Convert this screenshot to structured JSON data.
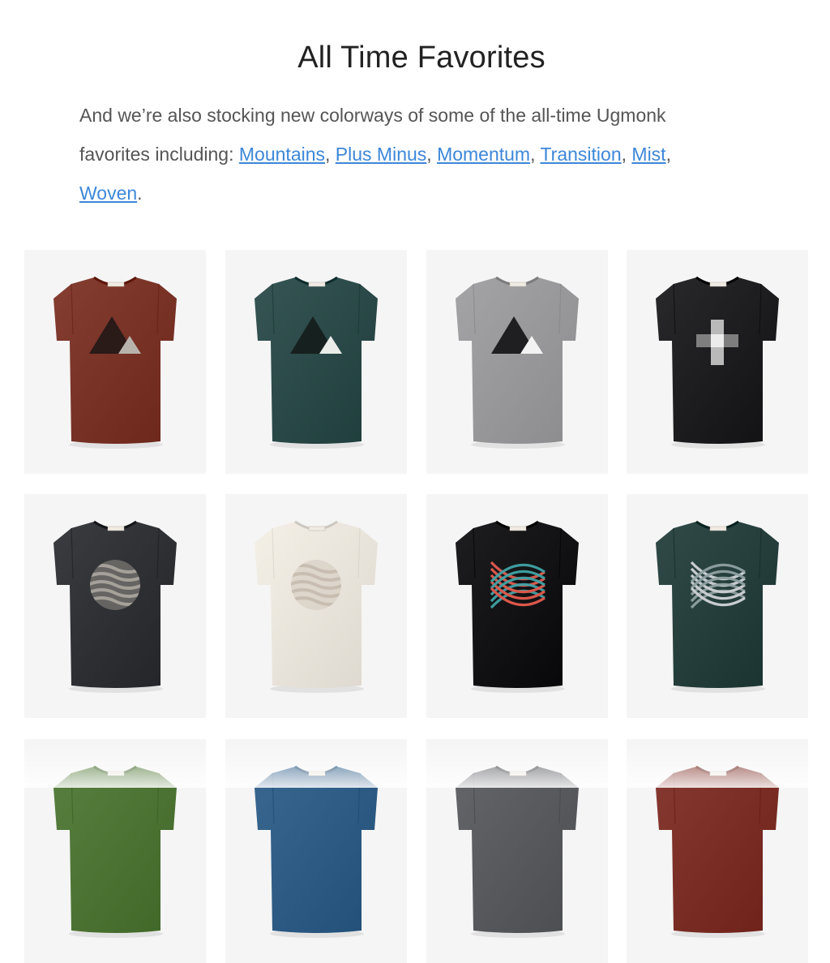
{
  "section": {
    "title": "All Time Favorites",
    "intro_line1": "And we’re also stocking new colorways of some of the all-time Ugmonk",
    "intro_prefix": "favorites including: ",
    "links": [
      "Mountains",
      "Plus Minus",
      "Momentum",
      "Transition",
      "Mist",
      "Woven"
    ],
    "separator": ", ",
    "end": "."
  },
  "products": [
    {
      "shirt_color": "#7a3428",
      "graphic": "mountains",
      "graphic_color": "#2a1a18",
      "accent_color": "#b9b3ad"
    },
    {
      "shirt_color": "#2c4b4a",
      "graphic": "mountains",
      "graphic_color": "#16201f",
      "accent_color": "#e9ece8"
    },
    {
      "shirt_color": "#9a9a9c",
      "graphic": "mountains",
      "graphic_color": "#1f1f21",
      "accent_color": "#f2f2f2"
    },
    {
      "shirt_color": "#1f1f21",
      "graphic": "plus",
      "graphic_color": "#d5d5d5",
      "accent_color": "#8a8a8a"
    },
    {
      "shirt_color": "#303236",
      "graphic": "mist",
      "graphic_color": "#8b8780",
      "accent_color": "#b5b0a8"
    },
    {
      "shirt_color": "#ebe6dd",
      "graphic": "mist",
      "graphic_color": "#d3cbbf",
      "accent_color": "#c2b8aa"
    },
    {
      "shirt_color": "#141416",
      "graphic": "woven",
      "graphic_color": "#d9574b",
      "accent_color": "#3fa3a7"
    },
    {
      "shirt_color": "#27403e",
      "graphic": "woven",
      "graphic_color": "#c7ccd0",
      "accent_color": "#8fa0a2"
    },
    {
      "shirt_color": "#4e7535",
      "graphic": "none",
      "graphic_color": "",
      "accent_color": ""
    },
    {
      "shirt_color": "#2f5d86",
      "graphic": "none",
      "graphic_color": "",
      "accent_color": ""
    },
    {
      "shirt_color": "#5a5b5f",
      "graphic": "none",
      "graphic_color": "",
      "accent_color": ""
    },
    {
      "shirt_color": "#7c2f26",
      "graphic": "none",
      "graphic_color": "",
      "accent_color": ""
    }
  ]
}
